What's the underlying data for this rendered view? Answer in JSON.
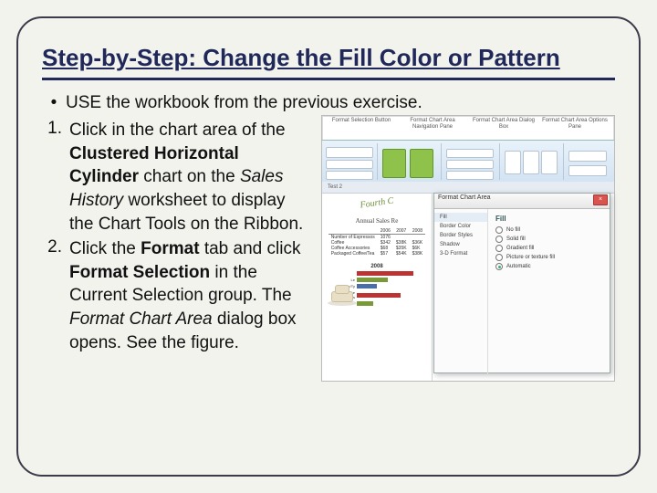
{
  "title": "Step-by-Step: Change the Fill Color or Pattern",
  "bullet": "USE the workbook from the previous exercise.",
  "steps": [
    {
      "num": "1.",
      "html": "Click in the chart area of the <b>Clustered Horizontal Cylinder</b> chart on the <i>Sales History</i> worksheet to display the Chart Tools on the Ribbon."
    },
    {
      "num": "2.",
      "html": "Click the <b>Format</b> tab and click <b>Format Selection</b> in the Current Selection group. The <i>Format Chart Area</i> dialog box opens. See the figure."
    }
  ],
  "figure": {
    "callouts": [
      "Format Selection Button",
      "Format Chart Area Navigation Pane",
      "Format Chart Area Dialog Box",
      "Format Chart Area Options Pane"
    ],
    "tab": "Test 2",
    "chart_title_script": "Fourth C",
    "subtitle": "Annual Sales Re",
    "table": {
      "cols": [
        "2006",
        "2007",
        "2008"
      ],
      "rows": [
        [
          "Number of Espressos",
          "1076",
          "--",
          "--"
        ],
        [
          "Coffee",
          "$342",
          "$38K",
          "$36K"
        ],
        [
          "Coffee Accessories",
          "$68",
          "$35K",
          "$6K"
        ],
        [
          "Packaged Coffee/Tea",
          "$57",
          "$54K",
          "$38K"
        ]
      ]
    },
    "mini_chart": {
      "title": "2008",
      "bars": [
        {
          "label": "",
          "w": 62,
          "cls": "b-red"
        },
        {
          "label": "Le",
          "w": 34,
          "cls": "b-grn"
        },
        {
          "label": "Le/Ty",
          "w": 22,
          "cls": "b-blu"
        },
        {
          "label": "Coffee Accessories",
          "w": 48,
          "cls": "b-red"
        },
        {
          "label": "",
          "w": 18,
          "cls": "b-grn"
        }
      ]
    },
    "dialog": {
      "title": "Format Chart Area",
      "side": [
        "Fill",
        "Border Color",
        "Border Styles",
        "Shadow",
        "3-D Format"
      ],
      "heading": "Fill",
      "options": [
        "No fill",
        "Solid fill",
        "Gradient fill",
        "Picture or texture fill",
        "Automatic"
      ],
      "selected": 4
    }
  }
}
